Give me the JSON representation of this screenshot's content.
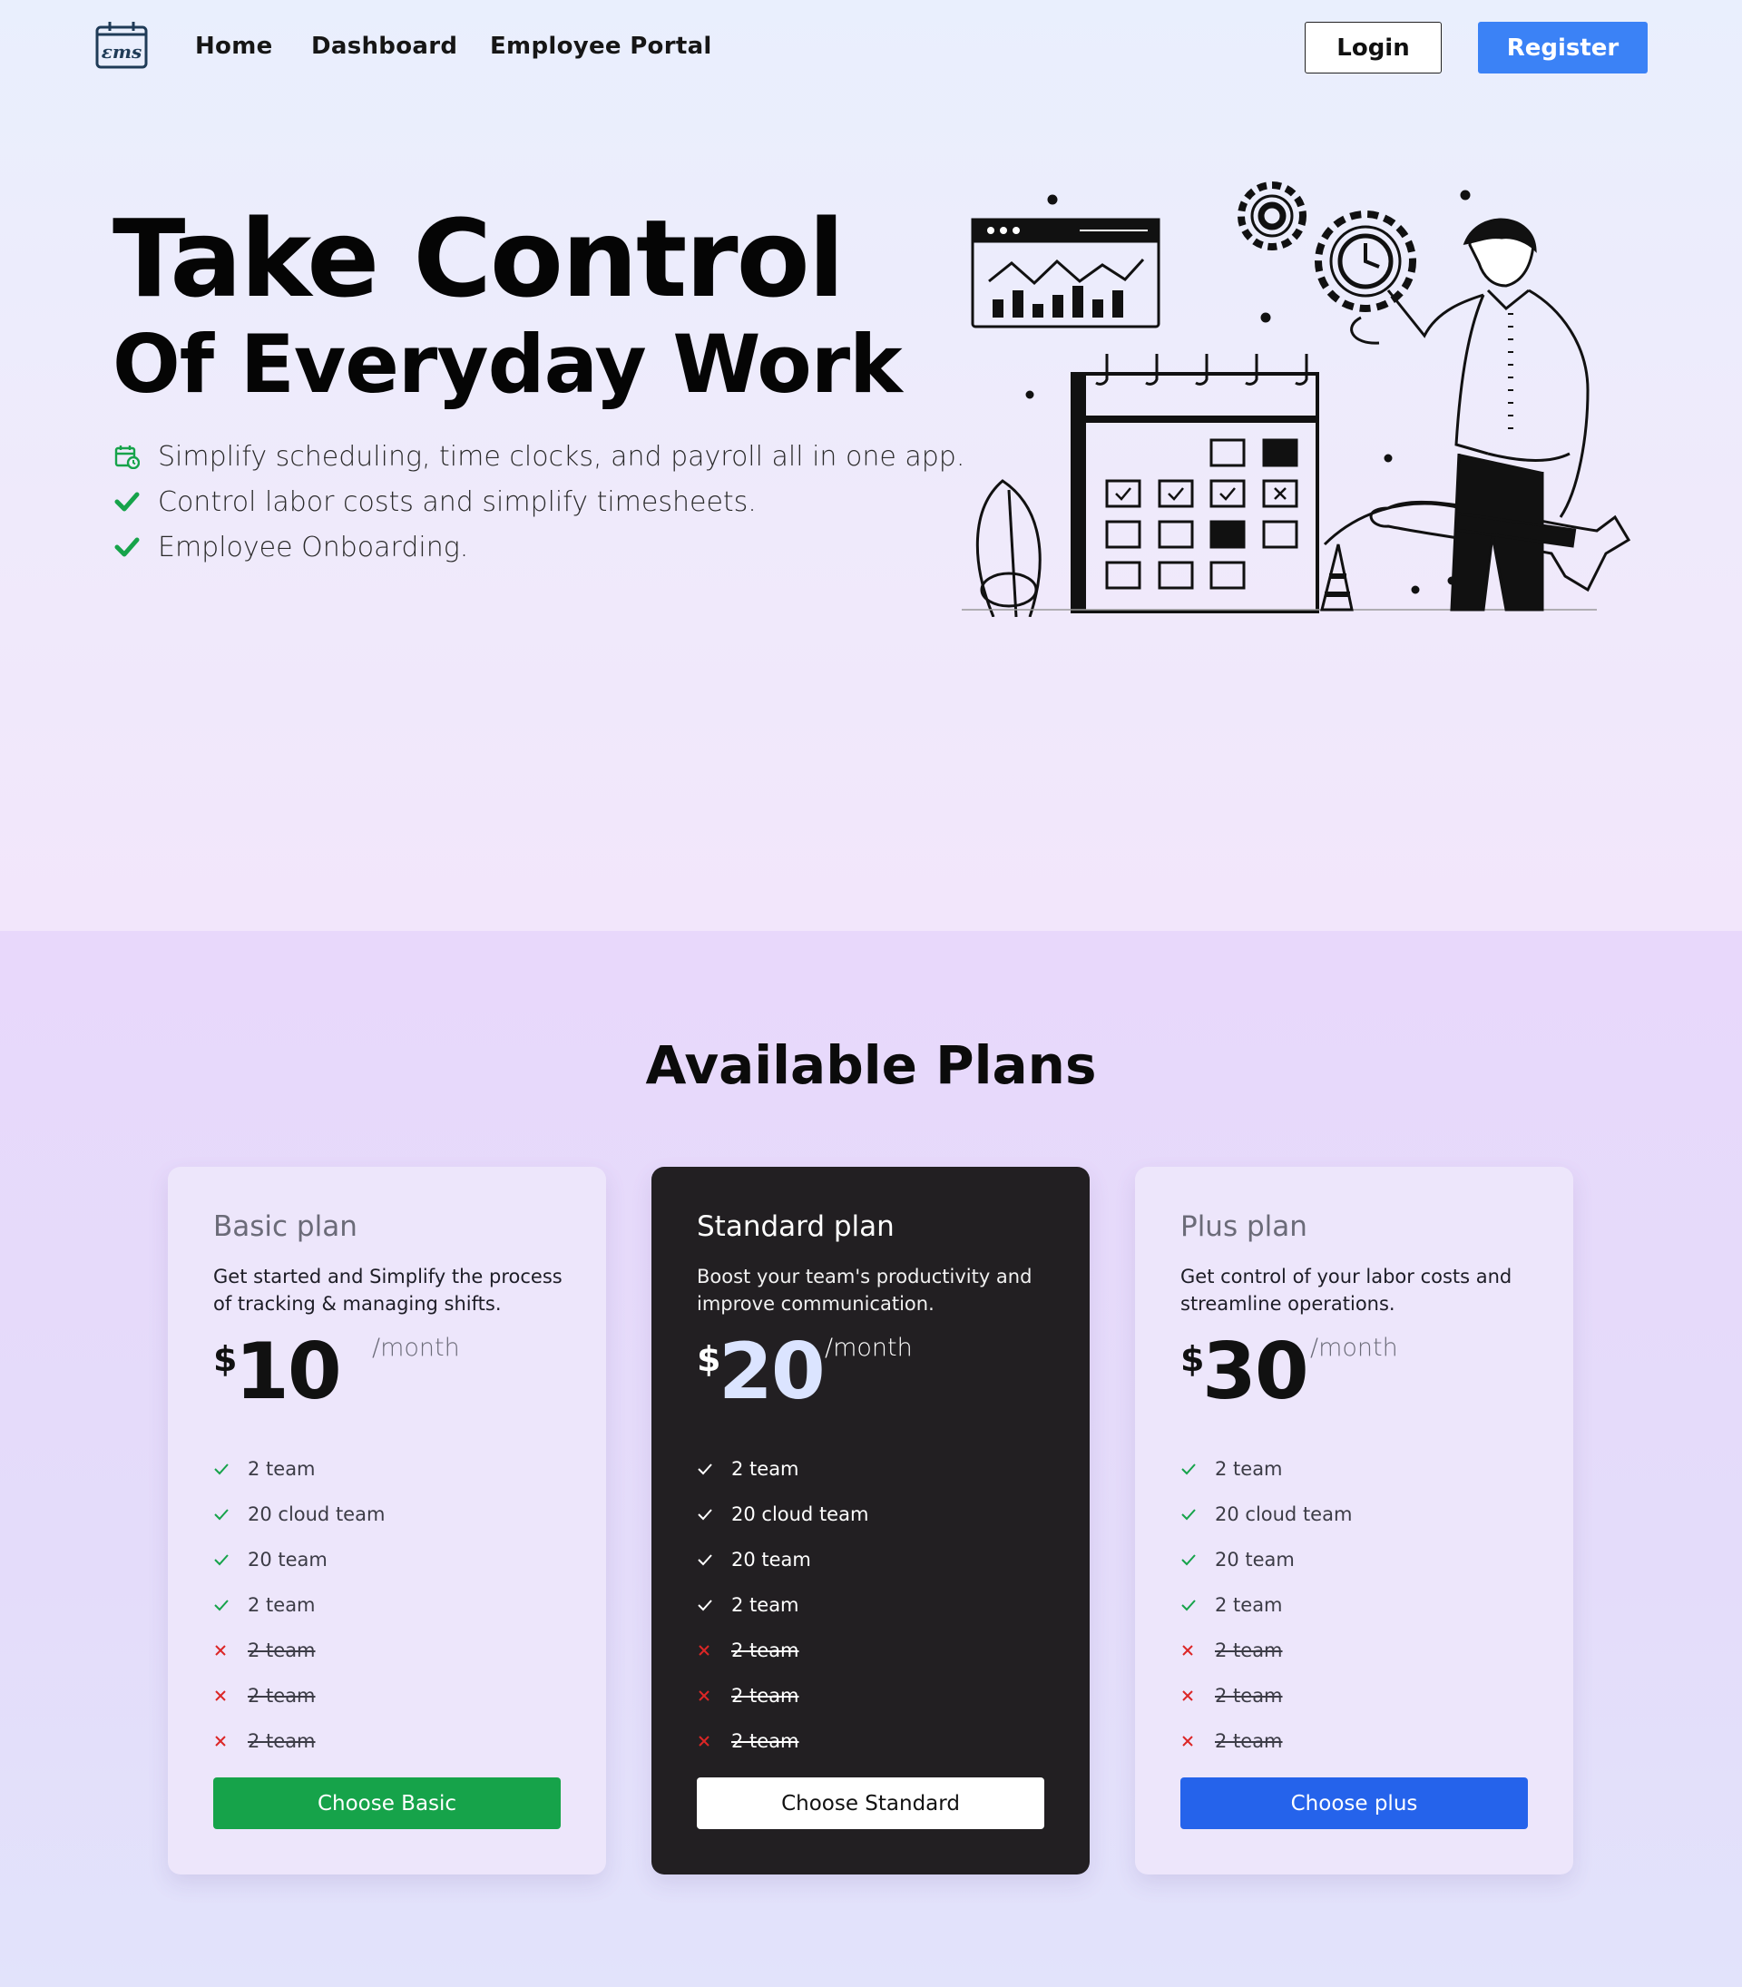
{
  "nav": {
    "logo_text": "εms",
    "links": [
      "Home",
      "Dashboard",
      "Employee Portal"
    ],
    "login_label": "Login",
    "register_label": "Register"
  },
  "hero": {
    "title_line1": "Take Control",
    "title_line2": "Of Everyday Work",
    "features": [
      {
        "text": "Simplify scheduling, time clocks, and payroll all in one app.",
        "icon": "calendar-clock-icon"
      },
      {
        "text": "Control labor costs and simplify timesheets.",
        "icon": "check-icon"
      },
      {
        "text": "Employee Onboarding.",
        "icon": "check-icon"
      }
    ]
  },
  "plans": {
    "title": "Available Plans",
    "cards": [
      {
        "name": "Basic plan",
        "description": "Get started and Simplify the process of tracking & managing shifts.",
        "currency": "$",
        "price": "10",
        "period": "/month",
        "features": [
          {
            "text": "2 team",
            "included": true
          },
          {
            "text": "20 cloud team",
            "included": true
          },
          {
            "text": "20 team",
            "included": true
          },
          {
            "text": "2 team",
            "included": true
          },
          {
            "text": "2 team",
            "included": false
          },
          {
            "text": "2 team",
            "included": false
          },
          {
            "text": "2 team",
            "included": false
          }
        ],
        "cta": "Choose Basic",
        "cta_color": "#16a34a"
      },
      {
        "name": "Standard plan",
        "description": "Boost your team's productivity and improve communication.",
        "currency": "$",
        "price": "20",
        "period": "/month",
        "features": [
          {
            "text": "2 team",
            "included": true
          },
          {
            "text": "20 cloud team",
            "included": true
          },
          {
            "text": "20 team",
            "included": true
          },
          {
            "text": "2 team",
            "included": true
          },
          {
            "text": "2 team",
            "included": false
          },
          {
            "text": "2 team",
            "included": false
          },
          {
            "text": "2 team",
            "included": false
          }
        ],
        "cta": "Choose Standard",
        "cta_color": "#ffffff"
      },
      {
        "name": "Plus plan",
        "description": "Get control of your labor costs and streamline operations.",
        "currency": "$",
        "price": "30",
        "period": "/month",
        "features": [
          {
            "text": "2 team",
            "included": true
          },
          {
            "text": "20 cloud team",
            "included": true
          },
          {
            "text": "20 team",
            "included": true
          },
          {
            "text": "2 team",
            "included": true
          },
          {
            "text": "2 team",
            "included": false
          },
          {
            "text": "2 team",
            "included": false
          },
          {
            "text": "2 team",
            "included": false
          }
        ],
        "cta": "Choose plus",
        "cta_color": "#2563eb"
      }
    ]
  },
  "colors": {
    "accent_blue": "#3b82f6",
    "check_green": "#16a34a",
    "cross_red": "#dc2626",
    "dark_card": "#221f22"
  }
}
